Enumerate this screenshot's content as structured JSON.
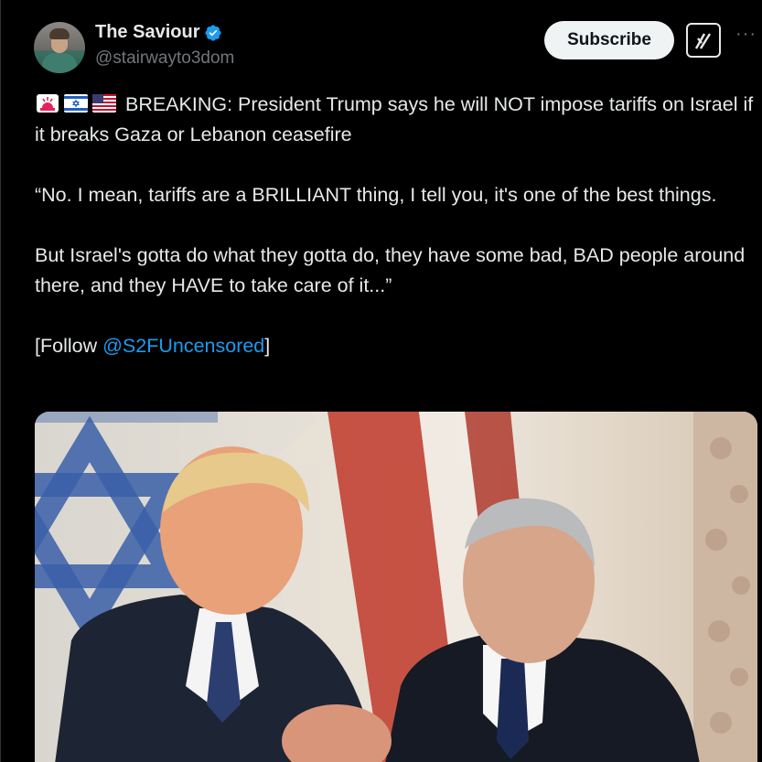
{
  "author": {
    "display_name": "The Saviour",
    "handle": "@stairwayto3dom",
    "verified_icon": "verified-badge-icon",
    "verified_color": "#1d9bf0"
  },
  "actions": {
    "subscribe_label": "Subscribe",
    "grok_icon": "grok-icon",
    "more_label": "···"
  },
  "tweet": {
    "emojis": [
      "rotating-light-icon",
      "israel-flag-icon",
      "us-flag-icon"
    ],
    "line1": " BREAKING: President Trump says he will NOT impose tariffs on Israel if it breaks Gaza or Lebanon ceasefire",
    "paragraph2": "“No. I mean, tariffs are a BRILLIANT thing, I tell you, it's one of the best things.",
    "paragraph3": "But Israel's gotta do what they gotta do, they have some bad, BAD people around there, and they HAVE to take care of it...”",
    "follow_prefix": "[Follow ",
    "follow_mention": "@S2FUncensored",
    "follow_suffix": "]"
  },
  "colors": {
    "background": "#000000",
    "text": "#e7e9ea",
    "secondary_text": "#71767b",
    "link": "#1d9bf0",
    "button_bg": "#eff3f4"
  }
}
